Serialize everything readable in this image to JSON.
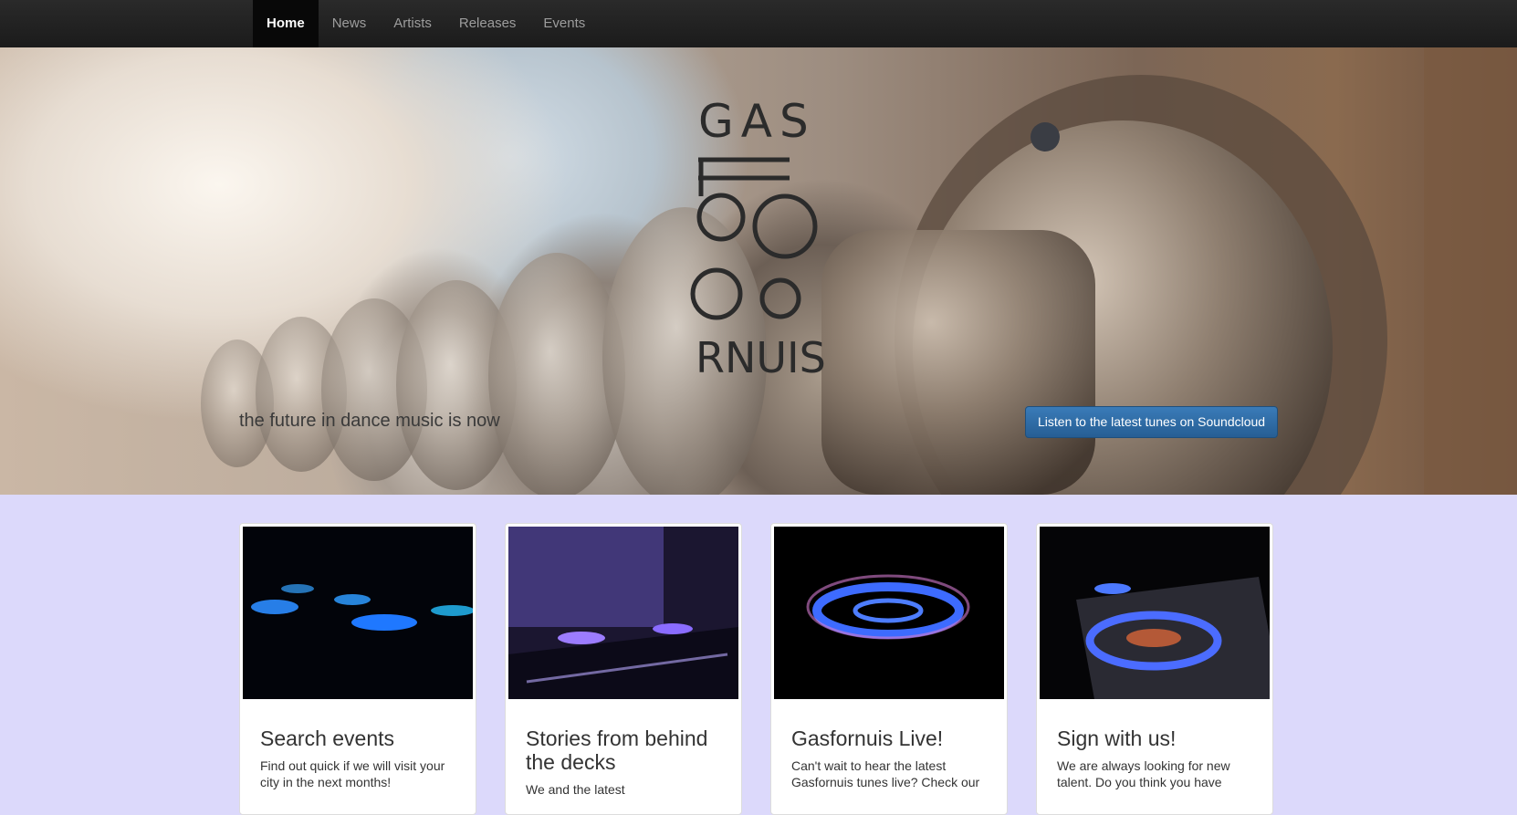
{
  "nav": {
    "items": [
      {
        "label": "Home",
        "active": true
      },
      {
        "label": "News",
        "active": false
      },
      {
        "label": "Artists",
        "active": false
      },
      {
        "label": "Releases",
        "active": false
      },
      {
        "label": "Events",
        "active": false
      }
    ]
  },
  "hero": {
    "logo_top": "GAS",
    "logo_bottom": "RNUIS",
    "tagline": "the future in dance music is now",
    "cta_label": "Listen to the latest tunes on Soundcloud"
  },
  "cards": [
    {
      "title": "Search events",
      "text": "Find out quick if we will visit your city in the next months!",
      "image": "gas-burners-blue-icon"
    },
    {
      "title": "Stories from behind the decks",
      "text": "We and the latest",
      "image": "stove-flames-purple-icon"
    },
    {
      "title": "Gasfornuis Live!",
      "text": "Can't wait to hear the latest Gasfornuis tunes live? Check our",
      "image": "gas-ring-flame-icon"
    },
    {
      "title": "Sign with us!",
      "text": "We are always looking for new talent. Do you think you have",
      "image": "burner-flame-icon"
    }
  ],
  "colors": {
    "page_bg": "#dcd9fb",
    "navbar": "#1b1b1b",
    "cta": "#2f6ea8"
  }
}
